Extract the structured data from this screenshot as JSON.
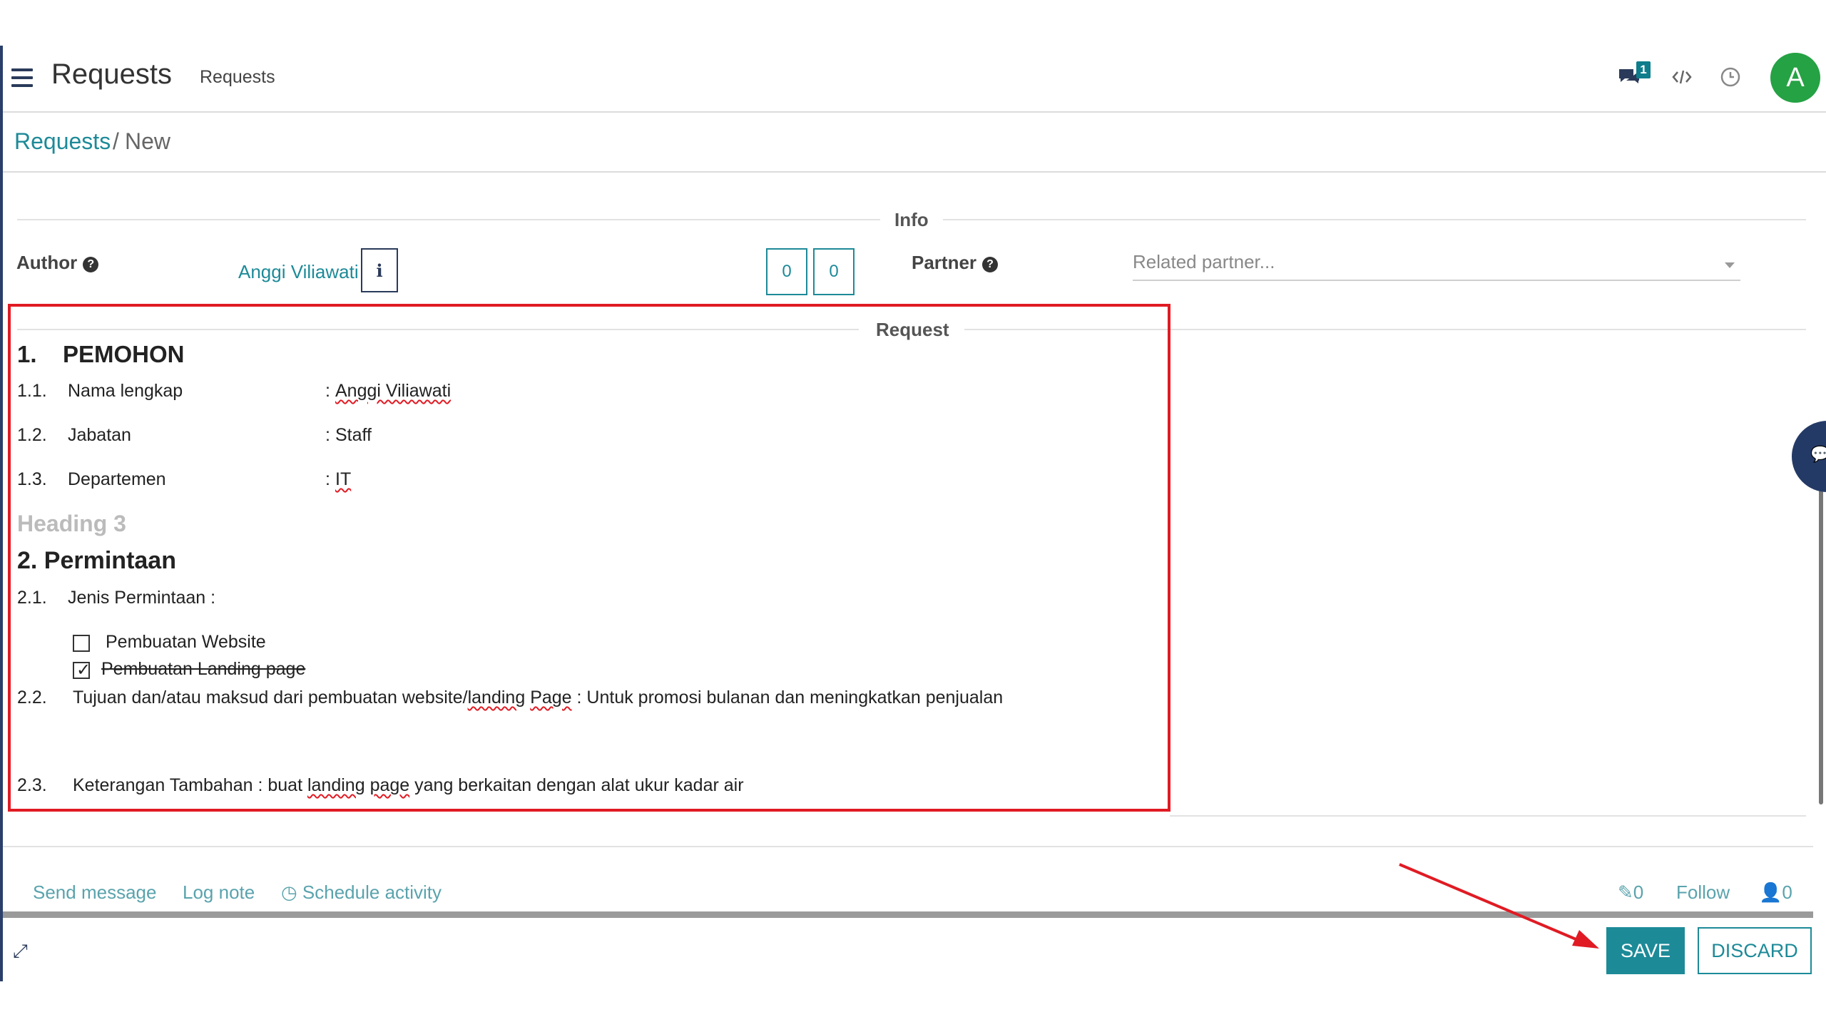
{
  "topbar": {
    "title": "Requests",
    "subtitle": "Requests",
    "chat_badge": "1",
    "avatar_letter": "A",
    "avatar_color": "#25a244"
  },
  "breadcrumb": {
    "parent": "Requests",
    "separator": "/",
    "current": "New"
  },
  "form": {
    "info_section": "Info",
    "author_label": "Author",
    "author_value": "Anggi Viliawati",
    "info_button": "i",
    "count_a": "0",
    "count_b": "0",
    "partner_label": "Partner",
    "partner_placeholder": "Related partner...",
    "request_section": "Request",
    "help_glyph": "?"
  },
  "request": {
    "h1_num": "1.",
    "h1_text": "PEMOHON",
    "rows": [
      {
        "num": "1.1.",
        "label": "Nama lengkap",
        "colon": ":",
        "value": "Anggi Viliawati"
      },
      {
        "num": "1.2.",
        "label": "Jabatan",
        "colon": ":",
        "value": "Staff"
      },
      {
        "num": "1.3.",
        "label": "Departemen",
        "colon": ":",
        "value": "IT"
      }
    ],
    "heading3": "Heading 3",
    "h2": "2. Permintaan",
    "r21_num": "2.1.",
    "r21_text": "Jenis Permintaan :",
    "checklist": [
      {
        "label": "Pembuatan Website",
        "checked": false
      },
      {
        "label": "Pembuatan Landing page",
        "checked": true
      }
    ],
    "r22_num": "2.2.",
    "r22_pre": "Tujuan dan/atau maksud dari pembuatan website/",
    "r22_w1": "landing",
    "r22_sp": " ",
    "r22_w2": "Page",
    "r22_post": " : Untuk promosi bulanan dan meningkatkan penjualan",
    "r23_num": "2.3.",
    "r23_pre": "Keterangan Tambahan : buat ",
    "r23_w1": "landing",
    "r23_sp": " ",
    "r23_w2": "page",
    "r23_post": " yang berkaitan dengan alat ukur kadar air"
  },
  "chatter": {
    "send_message": "Send message",
    "log_note": "Log note",
    "schedule_activity": "Schedule activity",
    "attachments_count": "0",
    "follow": "Follow",
    "followers_count": "0"
  },
  "actions": {
    "save": "SAVE",
    "discard": "DISCARD"
  }
}
